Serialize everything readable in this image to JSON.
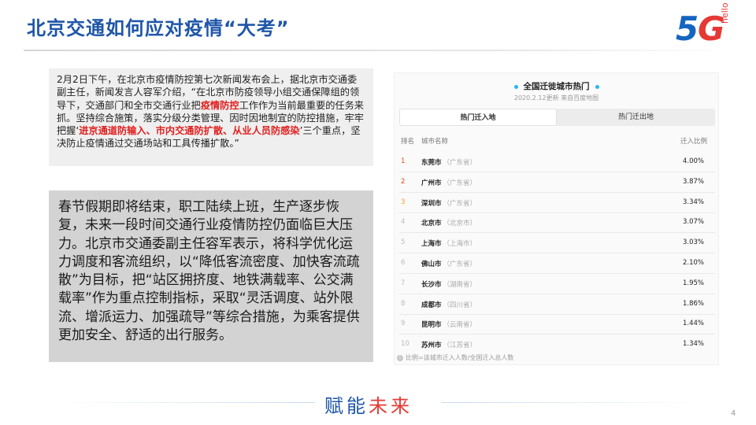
{
  "header": {
    "title": "北京交通如何应对疫情“大考”",
    "logo_main": "5",
    "logo_g": "G",
    "logo_hello": "hello"
  },
  "quote": {
    "part1": "2月2日下午，在北京市疫情防控第七次新闻发布会上，据北京市交通委副主任，新闻发言人容军介绍，“在北京市防疫领导小组交通保障组的领导下，交通部门和全市交通行业把",
    "highlight1": "疫情防控",
    "part2": "工作作为当前最重要的任务来抓。坚持综合施策，落实分级分类管理、因时因地制宜的防控措施，牢牢把握‘",
    "highlight2": "进京通道防输入、市内交通防扩散、从业人员防感染",
    "part3": "’三个重点，坚决防止疫情通过交通场站和工具传播扩散。”"
  },
  "main_text": "春节假期即将结束，职工陆续上班，生产逐步恢复，未来一段时间交通行业疫情防控仍面临巨大压力。北京市交通委副主任容军表示，将科学优化运力调度和客流组织，以“降低客流密度、加快客流疏散”为目标，把“站区拥挤度、地铁满载率、公交满载率”作为重点控制指标，采取“灵活调度、站外限流、增派运力、加强疏导”等综合措施，为乘客提供更加安全、舒适的出行服务。",
  "panel": {
    "title": "全国迁徙城市热门",
    "subtitle": "2020.2.12更新  来自百度地图",
    "tab_active": "热门迁入地",
    "tab_inactive": "热门迁出地",
    "col_rank": "排名",
    "col_city": "城市名称",
    "col_pct": "迁入比例",
    "rows": [
      {
        "rank": "1",
        "city": "东莞市",
        "prov": "（广东省）",
        "pct": "4.00%"
      },
      {
        "rank": "2",
        "city": "广州市",
        "prov": "（广东省）",
        "pct": "3.87%"
      },
      {
        "rank": "3",
        "city": "深圳市",
        "prov": "（广东省）",
        "pct": "3.34%"
      },
      {
        "rank": "4",
        "city": "北京市",
        "prov": "（北京市）",
        "pct": "3.07%"
      },
      {
        "rank": "5",
        "city": "上海市",
        "prov": "（上海市）",
        "pct": "3.03%"
      },
      {
        "rank": "6",
        "city": "佛山市",
        "prov": "（广东省）",
        "pct": "2.10%"
      },
      {
        "rank": "7",
        "city": "长沙市",
        "prov": "（湖南省）",
        "pct": "1.95%"
      },
      {
        "rank": "8",
        "city": "成都市",
        "prov": "（四川省）",
        "pct": "1.86%"
      },
      {
        "rank": "9",
        "city": "昆明市",
        "prov": "（云南省）",
        "pct": "1.44%"
      },
      {
        "rank": "10",
        "city": "苏州市",
        "prov": "（江苏省）",
        "pct": "1.34%"
      }
    ],
    "note": "比例=该城市迁入人数/全国迁入总人数",
    "note_icon": "i"
  },
  "footer": {
    "text_a": "赋能",
    "text_b": "未来",
    "page": "4"
  }
}
